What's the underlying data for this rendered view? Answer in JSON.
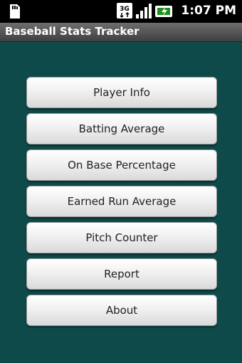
{
  "status_bar": {
    "time": "1:07 PM",
    "network_badge": "3G",
    "icons": [
      "sd-card-icon",
      "network-3g-icon",
      "signal-strength-icon",
      "battery-charging-icon"
    ]
  },
  "app": {
    "title": "Baseball Stats Tracker"
  },
  "menu": {
    "items": [
      {
        "label": "Player Info"
      },
      {
        "label": "Batting Average"
      },
      {
        "label": "On Base Percentage"
      },
      {
        "label": "Earned Run Average"
      },
      {
        "label": "Pitch Counter"
      },
      {
        "label": "Report"
      },
      {
        "label": "About"
      }
    ]
  },
  "colors": {
    "background": "#0f4a4a",
    "button_text": "#222222"
  }
}
